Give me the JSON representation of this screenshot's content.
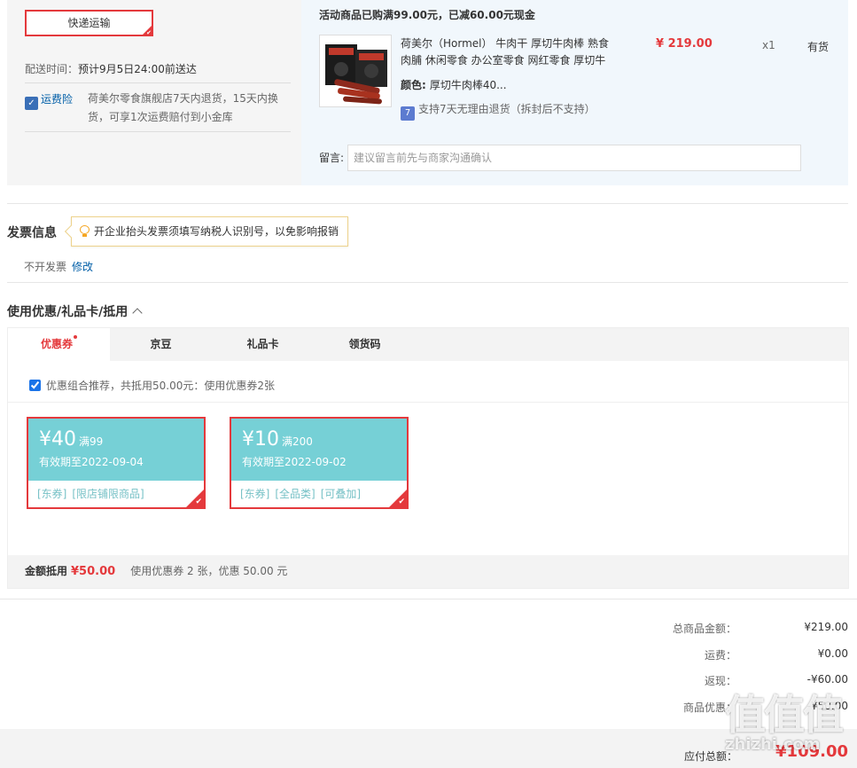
{
  "shipping": {
    "express_label": "快递运输",
    "delivery_label": "配送时间：",
    "delivery_value": "预计9月5日24:00前送达",
    "insurance_label": "运费险",
    "insurance_text": "荷美尔零食旗舰店7天内退货，15天内换货，可享1次运费赔付到小金库"
  },
  "promotion": {
    "title": "活动商品已购满99.00元，已减60.00元现金"
  },
  "product": {
    "name": "荷美尔（Hormel） 牛肉干 厚切牛肉棒 熟食肉脯 休闲零食 办公室零食 网红零食 厚切牛",
    "price": "¥ 219.00",
    "qty": "x1",
    "stock": "有货",
    "color_label": "颜色:",
    "color_value": "厚切牛肉棒40...",
    "return_policy": "支持7天无理由退货（拆封后不支持）"
  },
  "message": {
    "label": "留言:",
    "placeholder": "建议留言前先与商家沟通确认"
  },
  "invoice": {
    "title": "发票信息",
    "tip": "开企业抬头发票须填写纳税人识别号，以免影响报销",
    "value": "不开发票",
    "edit": "修改"
  },
  "coupons": {
    "section_title": "使用优惠/礼品卡/抵用",
    "tabs": [
      {
        "label": "优惠券"
      },
      {
        "label": "京豆"
      },
      {
        "label": "礼品卡"
      },
      {
        "label": "领货码"
      }
    ],
    "combo_text": "优惠组合推荐，共抵用50.00元：使用优惠券2张",
    "items": [
      {
        "amount": "¥40",
        "condition": "满99",
        "expiry": "有效期至2022-09-04",
        "tags": [
          "[东券]",
          "[限店铺限商品]"
        ]
      },
      {
        "amount": "¥10",
        "condition": "满200",
        "expiry": "有效期至2022-09-02",
        "tags": [
          "[东券]",
          "[全品类]",
          "[可叠加]"
        ]
      }
    ],
    "foot_label": "金额抵用",
    "foot_amount": "¥50.00",
    "foot_desc": "使用优惠券 2 张，优惠 50.00 元"
  },
  "totals": {
    "rows": [
      {
        "label": "总商品金额：",
        "value": "¥219.00"
      },
      {
        "label": "运费：",
        "value": "¥0.00"
      },
      {
        "label": "返现：",
        "value": "-¥60.00"
      },
      {
        "label": "商品优惠：",
        "value": "-¥50.00"
      }
    ],
    "pay_label": "应付总额：",
    "pay_value": "¥109.00"
  },
  "watermark": {
    "logo": "值值值",
    "text": "zhizhi.com"
  },
  "colors": {
    "accent": "#e4393c",
    "coupon": "#76d0d6",
    "link": "#005ea7"
  }
}
